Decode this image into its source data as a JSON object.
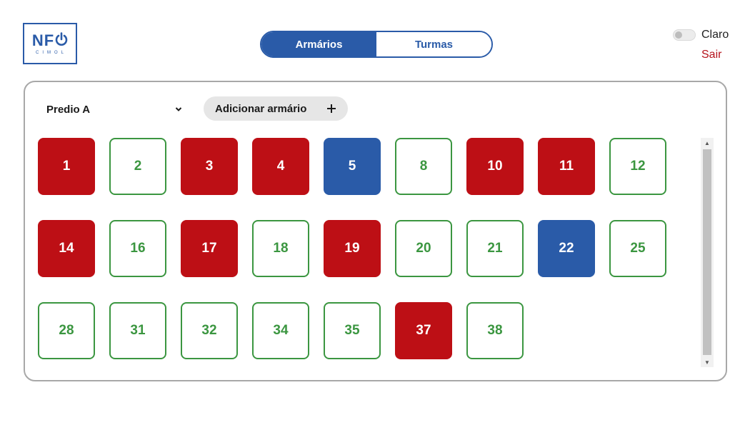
{
  "logo": {
    "main": "NF",
    "sub": "CIMOL"
  },
  "nav": {
    "tabs": [
      {
        "label": "Armários",
        "active": true
      },
      {
        "label": "Turmas",
        "active": false
      }
    ]
  },
  "theme": {
    "label": "Claro"
  },
  "logout": {
    "label": "Sair"
  },
  "colors": {
    "brand_blue": "#2a5ba8",
    "occupied_red": "#bd0f15",
    "free_green": "#3b9640"
  },
  "filter": {
    "building": "Predio A"
  },
  "add_button": {
    "label": "Adicionar armário",
    "icon": "plus-icon"
  },
  "lockers": [
    {
      "number": "1",
      "status": "occupied"
    },
    {
      "number": "2",
      "status": "free"
    },
    {
      "number": "3",
      "status": "occupied"
    },
    {
      "number": "4",
      "status": "occupied"
    },
    {
      "number": "5",
      "status": "selected"
    },
    {
      "number": "8",
      "status": "free"
    },
    {
      "number": "10",
      "status": "occupied"
    },
    {
      "number": "11",
      "status": "occupied"
    },
    {
      "number": "12",
      "status": "free"
    },
    {
      "number": "14",
      "status": "occupied"
    },
    {
      "number": "16",
      "status": "free"
    },
    {
      "number": "17",
      "status": "occupied"
    },
    {
      "number": "18",
      "status": "free"
    },
    {
      "number": "19",
      "status": "occupied"
    },
    {
      "number": "20",
      "status": "free"
    },
    {
      "number": "21",
      "status": "free"
    },
    {
      "number": "22",
      "status": "selected"
    },
    {
      "number": "25",
      "status": "free"
    },
    {
      "number": "28",
      "status": "free"
    },
    {
      "number": "31",
      "status": "free"
    },
    {
      "number": "32",
      "status": "free"
    },
    {
      "number": "34",
      "status": "free"
    },
    {
      "number": "35",
      "status": "free"
    },
    {
      "number": "37",
      "status": "occupied"
    },
    {
      "number": "38",
      "status": "free"
    }
  ]
}
